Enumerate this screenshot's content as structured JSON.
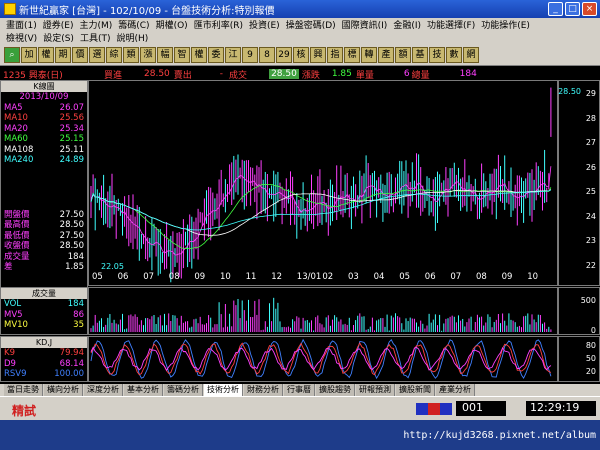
{
  "window": {
    "title": "新世紀贏家 [台灣] - 102/10/09 - 台盤技術分析:特別報價"
  },
  "menu": {
    "row1": [
      "畫面(1)",
      "證券(E)",
      "主力(M)",
      "籌碼(C)",
      "期權(O)",
      "匯市利率(R)",
      "投資(E)",
      "操盤密碼(D)",
      "國際資訊(I)",
      "金融(I)",
      "功能選擇(F)",
      "功能操作(E)"
    ],
    "row2": [
      "檢視(V)",
      "設定(S)",
      "工具(T)",
      "說明(H)"
    ]
  },
  "toolbar": {
    "buttons": [
      "加",
      "權",
      "期",
      "價",
      "選",
      "綜",
      "類",
      "漲",
      "幅",
      "智",
      "權",
      "委",
      "江",
      "9",
      "8",
      "29",
      "核",
      "興",
      "指",
      "標",
      "轉",
      "產",
      "額",
      "基",
      "技",
      "數",
      "網"
    ]
  },
  "quote": {
    "name": "1235 興泰(日)",
    "buy_label": "買進",
    "buy": "28.50",
    "sell_label": "賣出",
    "sell": "-",
    "deal_label": "成交",
    "deal": "28.50",
    "change_label": "漲跌",
    "change": "1.85",
    "unit_label": "單量",
    "unit": "6",
    "total_label": "總量",
    "total": "184"
  },
  "indicators": {
    "header": "K線圖",
    "date": "2013/10/09",
    "ma": [
      {
        "label": "MA5",
        "value": "26.07",
        "color": "#ff40ff"
      },
      {
        "label": "MA10",
        "value": "25.56",
        "color": "#ff4040"
      },
      {
        "label": "MA20",
        "value": "25.34",
        "color": "#ff40ff"
      },
      {
        "label": "MA60",
        "value": "25.15",
        "color": "#40ff40"
      },
      {
        "label": "MA108",
        "value": "25.11",
        "color": "#ffffff"
      },
      {
        "label": "MA240",
        "value": "24.89",
        "color": "#40ffff"
      }
    ],
    "prices": [
      {
        "label": "開盤價",
        "value": "27.50"
      },
      {
        "label": "最高價",
        "value": "28.50"
      },
      {
        "label": "最低價",
        "value": "27.50"
      },
      {
        "label": "收盤價",
        "value": "28.50"
      },
      {
        "label": "成交量",
        "value": "184"
      },
      {
        "label": "差",
        "value": "1.85"
      }
    ]
  },
  "price_axis": [
    "29",
    "28",
    "27",
    "26",
    "25",
    "24",
    "23",
    "22"
  ],
  "price_high_label": "28.50",
  "low_marker": "22.05",
  "date_axis": [
    "05",
    "06",
    "07",
    "08",
    "09",
    "10",
    "11",
    "12",
    "13/01",
    "02",
    "03",
    "04",
    "05",
    "06",
    "07",
    "08",
    "09",
    "10"
  ],
  "volume": {
    "header": "成交量",
    "rows": [
      {
        "label": "VOL",
        "value": "184",
        "color": "#40ffff"
      },
      {
        "label": "MV5",
        "value": "86",
        "color": "#ff40ff"
      },
      {
        "label": "MV10",
        "value": "35",
        "color": "#ffff40"
      }
    ],
    "axis": [
      "500",
      "0"
    ]
  },
  "kd": {
    "header": "KD,J",
    "rows": [
      {
        "label": "K9",
        "value": "79.94",
        "color": "#ff4040"
      },
      {
        "label": "D9",
        "value": "68.14",
        "color": "#ff40ff"
      },
      {
        "label": "RSV9",
        "value": "100.00",
        "color": "#4080ff"
      }
    ],
    "axis": [
      "80",
      "50",
      "20"
    ]
  },
  "tabs": [
    "當日走勢",
    "橫向分析",
    "深度分析",
    "基本分析",
    "籌碼分析",
    "技術分析",
    "財務分析",
    "行事曆",
    "擴股趨勢",
    "研報預測",
    "擴股新聞",
    "產業分析"
  ],
  "active_tab": "技術分析",
  "status": {
    "left": "精試",
    "code": "001",
    "time": "12:29:19"
  },
  "footer_url": "http://kujd3268.pixnet.net/album"
}
